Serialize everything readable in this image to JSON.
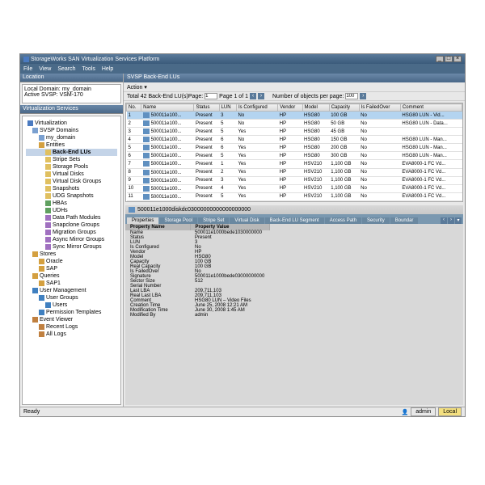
{
  "window": {
    "title": "StorageWorks SAN Virtualization Services Platform"
  },
  "menu": {
    "items": [
      "File",
      "View",
      "Search",
      "Tools",
      "Help"
    ]
  },
  "location": {
    "header": "Location",
    "domain_lbl": "Local Domain:",
    "domain_val": "my_domain",
    "active_lbl": "Active SVSP:",
    "active_val": "VSM-170"
  },
  "vs_header": "Virtualization Services",
  "tree": [
    {
      "l": 0,
      "t": "Virtualization",
      "ic": "ic-srv"
    },
    {
      "l": 1,
      "t": "SVSP Domains",
      "ic": "ic-dom"
    },
    {
      "l": 2,
      "t": "my_domain",
      "ic": "ic-dom"
    },
    {
      "l": 2,
      "t": "Entities",
      "ic": "ic-ent"
    },
    {
      "l": 3,
      "t": "Back-End LUs",
      "ic": "ic-lun",
      "sel": true
    },
    {
      "l": 3,
      "t": "Stripe Sets",
      "ic": "ic-lun"
    },
    {
      "l": 3,
      "t": "Storage Pools",
      "ic": "ic-lun"
    },
    {
      "l": 3,
      "t": "Virtual Disks",
      "ic": "ic-lun"
    },
    {
      "l": 3,
      "t": "Virtual Disk Groups",
      "ic": "ic-lun"
    },
    {
      "l": 3,
      "t": "Snapshots",
      "ic": "ic-lun"
    },
    {
      "l": 3,
      "t": "UDG Snapshots",
      "ic": "ic-lun"
    },
    {
      "l": 3,
      "t": "HBAs",
      "ic": "ic-hba"
    },
    {
      "l": 3,
      "t": "UDHs",
      "ic": "ic-hba"
    },
    {
      "l": 3,
      "t": "Data Path Modules",
      "ic": "ic-str"
    },
    {
      "l": 3,
      "t": "Snapclone Groups",
      "ic": "ic-str"
    },
    {
      "l": 3,
      "t": "Migration Groups",
      "ic": "ic-str"
    },
    {
      "l": 3,
      "t": "Async Mirror Groups",
      "ic": "ic-str"
    },
    {
      "l": 3,
      "t": "Sync Mirror Groups",
      "ic": "ic-str"
    },
    {
      "l": 1,
      "t": "Stores",
      "ic": "ic-ent"
    },
    {
      "l": 2,
      "t": "Oracle",
      "ic": "ic-ent"
    },
    {
      "l": 2,
      "t": "SAP",
      "ic": "ic-ent"
    },
    {
      "l": 1,
      "t": "Queries",
      "ic": "ic-ent"
    },
    {
      "l": 2,
      "t": "SAP1",
      "ic": "ic-ent"
    },
    {
      "l": 1,
      "t": "User Management",
      "ic": "ic-usr"
    },
    {
      "l": 2,
      "t": "User Groups",
      "ic": "ic-usr"
    },
    {
      "l": 3,
      "t": "Users",
      "ic": "ic-usr"
    },
    {
      "l": 2,
      "t": "Permission Templates",
      "ic": "ic-usr"
    },
    {
      "l": 1,
      "t": "Event Viewer",
      "ic": "ic-ev"
    },
    {
      "l": 2,
      "t": "Recent Logs",
      "ic": "ic-ev"
    },
    {
      "l": 2,
      "t": "All Logs",
      "ic": "ic-ev"
    }
  ],
  "content": {
    "title": "SVSP Back-End LUs",
    "action": "Action ▾",
    "total": "Total 42 Back-End LU(s)",
    "page_lbl": "Page:",
    "page_val": "1",
    "page_of": "Page 1 of 1",
    "perpage_lbl": "Number of objects per page:",
    "perpage_val": "100"
  },
  "grid": {
    "cols": [
      "No.",
      "Name",
      "Status",
      "LUN",
      "Is Configured",
      "Vendor",
      "Model",
      "Capacity",
      "Is FailedOver",
      "Comment"
    ],
    "rows": [
      {
        "sel": true,
        "c": [
          "1",
          "500011e100...",
          "Present",
          "3",
          "No",
          "HP",
          "HSG80",
          "100 GB",
          "No",
          "HSG80 LUN - Vid..."
        ]
      },
      {
        "c": [
          "2",
          "500011e100...",
          "Present",
          "5",
          "No",
          "HP",
          "HSG80",
          "50 GB",
          "No",
          "HSG80 LUN - Data..."
        ]
      },
      {
        "c": [
          "3",
          "500011e100...",
          "Present",
          "5",
          "Yes",
          "HP",
          "HSG80",
          "45 GB",
          "No",
          ""
        ]
      },
      {
        "c": [
          "4",
          "500011e100...",
          "Present",
          "6",
          "No",
          "HP",
          "HSG80",
          "150 GB",
          "No",
          "HSG80 LUN - Man..."
        ]
      },
      {
        "c": [
          "5",
          "500011e100...",
          "Present",
          "6",
          "Yes",
          "HP",
          "HSG80",
          "200 GB",
          "No",
          "HSG80 LUN - Man..."
        ]
      },
      {
        "c": [
          "6",
          "500011e100...",
          "Present",
          "5",
          "Yes",
          "HP",
          "HSG80",
          "300 GB",
          "No",
          "HSG80 LUN - Man..."
        ]
      },
      {
        "c": [
          "7",
          "500011e100...",
          "Present",
          "1",
          "Yes",
          "HP",
          "HSV210",
          "1,100 GB",
          "No",
          "EVA8000-1 FC Vd..."
        ]
      },
      {
        "c": [
          "8",
          "500011e100...",
          "Present",
          "2",
          "Yes",
          "HP",
          "HSV210",
          "1,100 GB",
          "No",
          "EVA8000-1 FC Vd..."
        ]
      },
      {
        "c": [
          "9",
          "500011e100...",
          "Present",
          "3",
          "Yes",
          "HP",
          "HSV210",
          "1,100 GB",
          "No",
          "EVA8000-1 FC Vd..."
        ]
      },
      {
        "c": [
          "10",
          "500011e100...",
          "Present",
          "4",
          "Yes",
          "HP",
          "HSV210",
          "1,100 GB",
          "No",
          "EVA8000-1 FC Vd..."
        ]
      },
      {
        "c": [
          "11",
          "500011e100...",
          "Present",
          "5",
          "Yes",
          "HP",
          "HSV210",
          "1,100 GB",
          "No",
          "EVA8000-1 FC Vd..."
        ]
      }
    ]
  },
  "detail": {
    "title": "500011e1000diskdc03000000000000000000",
    "tabs": [
      "Properties",
      "Storage Pool",
      "Stripe Set",
      "Virtual Disk",
      "Back-End LU Segment",
      "Access Path",
      "Security",
      "Boundar"
    ],
    "prop_hdr": [
      "Property Name",
      "Property Value"
    ],
    "props": [
      [
        "Name",
        "500011e1000bede1030000000"
      ],
      [
        "Status",
        "Present"
      ],
      [
        "LUN",
        "3"
      ],
      [
        "Is Configured",
        "No"
      ],
      [
        "Vendor",
        "HP"
      ],
      [
        "Model",
        "HSG80"
      ],
      [
        "Capacity",
        "100 GB"
      ],
      [
        "Real Capacity",
        "100 GB"
      ],
      [
        "Is FailedOver",
        "No"
      ],
      [
        "Signature",
        "500011e1000bede03000000000"
      ],
      [
        "Sector Size",
        "512"
      ],
      [
        "Serial Number",
        ""
      ],
      [
        "Last LBA",
        "209,711,103"
      ],
      [
        "Real Last LBA",
        "209,711,103"
      ],
      [
        "Comment",
        "HSG80 LUN – Video Files"
      ],
      [
        "Creation Time",
        "June 25, 2008 12:21 AM"
      ],
      [
        "Modification Time",
        "June 30, 2008 1:45 AM"
      ],
      [
        "Modified By",
        "admin"
      ]
    ]
  },
  "status": {
    "ready": "Ready",
    "user_icon": "👤",
    "user": "admin",
    "level": "Local"
  }
}
